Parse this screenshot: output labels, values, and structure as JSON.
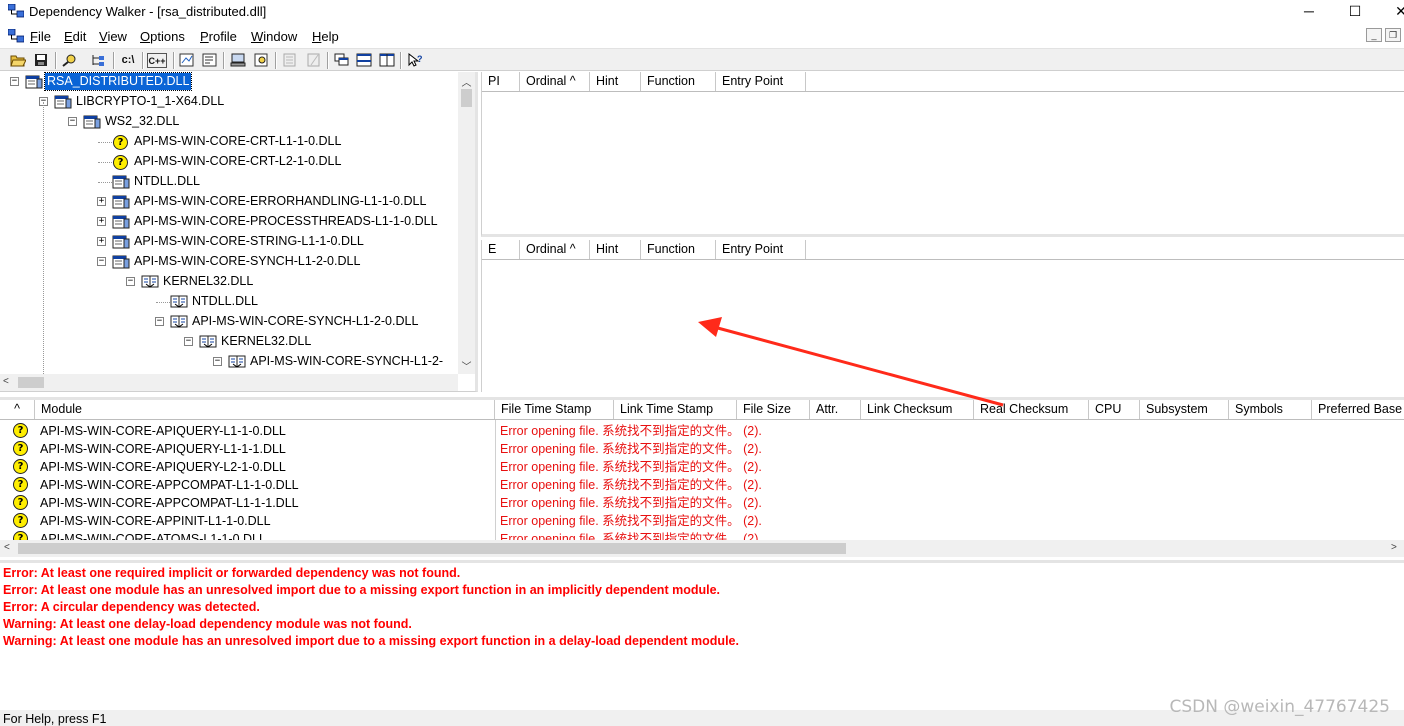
{
  "window": {
    "title": "Dependency Walker - [rsa_distributed.dll]",
    "minimize_glyph": "─",
    "maximize_glyph": "☐",
    "close_glyph": "✕"
  },
  "menu": [
    {
      "label": "File",
      "accel": "F",
      "rest": "ile"
    },
    {
      "label": "Edit",
      "accel": "E",
      "rest": "dit"
    },
    {
      "label": "View",
      "accel": "V",
      "rest": "iew"
    },
    {
      "label": "Options",
      "accel": "O",
      "rest": "ptions"
    },
    {
      "label": "Profile",
      "accel": "P",
      "rest": "rofile"
    },
    {
      "label": "Window",
      "accel": "W",
      "rest": "indow"
    },
    {
      "label": "Help",
      "accel": "H",
      "rest": "elp"
    }
  ],
  "mdi_buttons": {
    "minimize": "_",
    "restore": "❐"
  },
  "toolbar": {
    "c_drive": "c:\\",
    "cpp": "C++"
  },
  "tree": [
    {
      "label": "RSA_DISTRIBUTED.DLL",
      "depth": 0,
      "expander": "−",
      "icon": "module",
      "selected": true
    },
    {
      "label": "LIBCRYPTO-1_1-X64.DLL",
      "depth": 1,
      "expander": "−",
      "icon": "module"
    },
    {
      "label": "WS2_32.DLL",
      "depth": 2,
      "expander": "−",
      "icon": "module"
    },
    {
      "label": "API-MS-WIN-CORE-CRT-L1-1-0.DLL",
      "depth": 3,
      "expander": "",
      "icon": "missing"
    },
    {
      "label": "API-MS-WIN-CORE-CRT-L2-1-0.DLL",
      "depth": 3,
      "expander": "",
      "icon": "missing"
    },
    {
      "label": "NTDLL.DLL",
      "depth": 3,
      "expander": "",
      "icon": "module"
    },
    {
      "label": "API-MS-WIN-CORE-ERRORHANDLING-L1-1-0.DLL",
      "depth": 3,
      "expander": "+",
      "icon": "module"
    },
    {
      "label": "API-MS-WIN-CORE-PROCESSTHREADS-L1-1-0.DLL",
      "depth": 3,
      "expander": "+",
      "icon": "module"
    },
    {
      "label": "API-MS-WIN-CORE-STRING-L1-1-0.DLL",
      "depth": 3,
      "expander": "+",
      "icon": "module"
    },
    {
      "label": "API-MS-WIN-CORE-SYNCH-L1-2-0.DLL",
      "depth": 3,
      "expander": "−",
      "icon": "module"
    },
    {
      "label": "KERNEL32.DLL",
      "depth": 4,
      "expander": "−",
      "icon": "forward"
    },
    {
      "label": "NTDLL.DLL",
      "depth": 5,
      "expander": "",
      "icon": "forward"
    },
    {
      "label": "API-MS-WIN-CORE-SYNCH-L1-2-0.DLL",
      "depth": 5,
      "expander": "−",
      "icon": "forward"
    },
    {
      "label": "KERNEL32.DLL",
      "depth": 6,
      "expander": "−",
      "icon": "forward"
    },
    {
      "label": "API-MS-WIN-CORE-SYNCH-L1-2-",
      "depth": 7,
      "expander": "−",
      "icon": "forward"
    }
  ],
  "parent_imports_columns": [
    "PI",
    "Ordinal ^",
    "Hint",
    "Function",
    "Entry Point"
  ],
  "exports_columns": [
    "E",
    "Ordinal ^",
    "Hint",
    "Function",
    "Entry Point"
  ],
  "module_columns": [
    "^",
    "Module",
    "File Time Stamp",
    "Link Time Stamp",
    "File Size",
    "Attr.",
    "Link Checksum",
    "Real Checksum",
    "CPU",
    "Subsystem",
    "Symbols",
    "Preferred Base"
  ],
  "module_error_text": "Error opening file. 系统找不到指定的文件。 (2).",
  "modules": [
    "API-MS-WIN-CORE-APIQUERY-L1-1-0.DLL",
    "API-MS-WIN-CORE-APIQUERY-L1-1-1.DLL",
    "API-MS-WIN-CORE-APIQUERY-L2-1-0.DLL",
    "API-MS-WIN-CORE-APPCOMPAT-L1-1-0.DLL",
    "API-MS-WIN-CORE-APPCOMPAT-L1-1-1.DLL",
    "API-MS-WIN-CORE-APPINIT-L1-1-0.DLL",
    "API-MS-WIN-CORE-ATOMS-L1-1-0.DLL"
  ],
  "log": [
    "Error: At least one required implicit or forwarded dependency was not found.",
    "Error: At least one module has an unresolved import due to a missing export function in an implicitly dependent module.",
    "Error: A circular dependency was detected.",
    "Warning: At least one delay-load dependency module was not found.",
    "Warning: At least one module has an unresolved import due to a missing export function in a delay-load dependent module."
  ],
  "status": "For Help, press F1",
  "watermark": "CSDN @weixin_47767425",
  "colors": {
    "error_red": "#ff0000",
    "selection_blue": "#0a64d6",
    "annotation_arrow": "#ff2a1a",
    "missing_icon": "#ffee00"
  }
}
